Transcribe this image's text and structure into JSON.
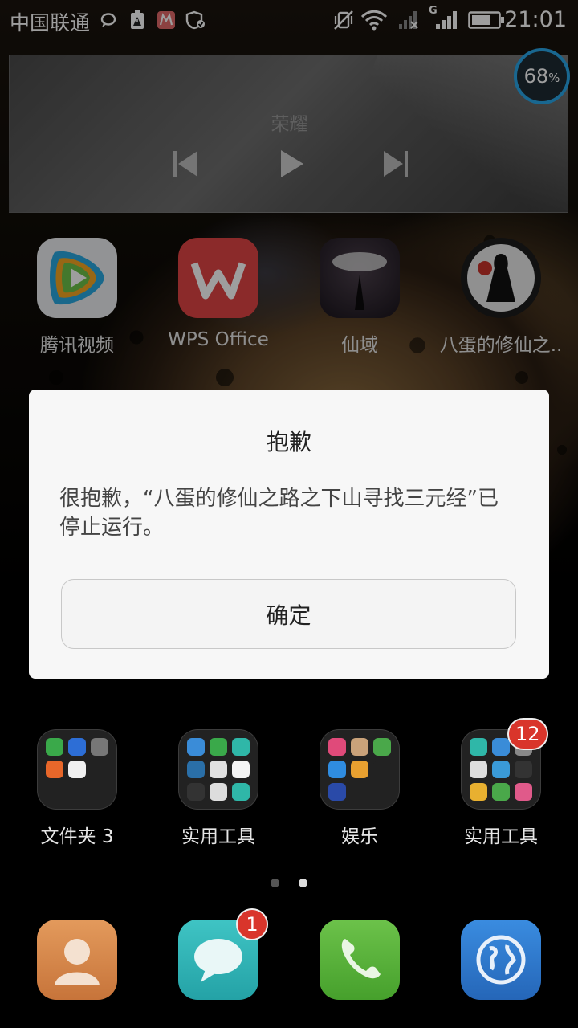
{
  "status_bar": {
    "carrier": "中国联通",
    "network_type": "G",
    "battery_icon": "battery-icon",
    "time": "21:01"
  },
  "music_widget": {
    "song_title": "荣耀",
    "controls": [
      "previous-track-icon",
      "play-icon",
      "next-track-icon"
    ]
  },
  "boost_widget": {
    "value": "68",
    "unit": "%"
  },
  "apps_row1": [
    {
      "label": "腾讯视频",
      "icon": "tencent-video-icon"
    },
    {
      "label": "WPS Office",
      "icon": "wps-office-icon"
    },
    {
      "label": "仙域",
      "icon": "xianyu-game-icon"
    },
    {
      "label": "八蛋的修仙之..",
      "icon": "badan-game-icon"
    }
  ],
  "folders": [
    {
      "label": "文件夹 3"
    },
    {
      "label": "实用工具"
    },
    {
      "label": "娱乐"
    },
    {
      "label": "实用工具",
      "badge": "12"
    }
  ],
  "page_indicator": {
    "pages": 2,
    "current": 2
  },
  "dock": [
    {
      "icon": "contacts-icon"
    },
    {
      "icon": "messages-icon",
      "badge": "1"
    },
    {
      "icon": "phone-icon"
    },
    {
      "icon": "browser-icon"
    }
  ],
  "dialog": {
    "title": "抱歉",
    "message": "很抱歉，“八蛋的修仙之路之下山寻找三元经”已停止运行。",
    "ok_label": "确定"
  }
}
